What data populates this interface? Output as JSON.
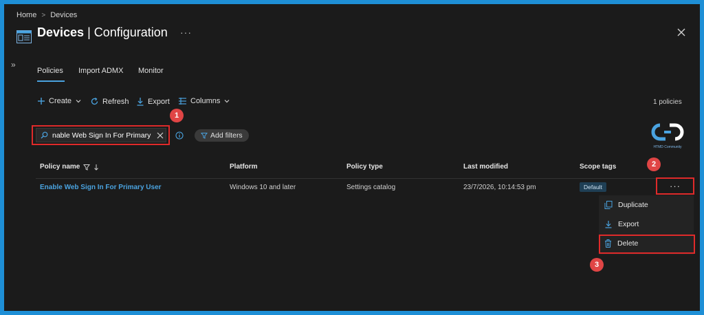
{
  "breadcrumb": {
    "home": "Home",
    "current": "Devices",
    "separator": ">"
  },
  "header": {
    "title_bold": "Devices",
    "title_rest": " | Configuration",
    "more": "···"
  },
  "tabs": [
    {
      "label": "Policies",
      "selected": true
    },
    {
      "label": "Import ADMX",
      "selected": false
    },
    {
      "label": "Monitor",
      "selected": false
    }
  ],
  "toolbar": {
    "create": "Create",
    "refresh": "Refresh",
    "export": "Export",
    "columns": "Columns",
    "count": "1 policies"
  },
  "search": {
    "value": "nable Web Sign In For Primary"
  },
  "filters": {
    "add_label": "Add filters"
  },
  "logo": {
    "text": "HTMD Community"
  },
  "table": {
    "headers": [
      "Policy name",
      "Platform",
      "Policy type",
      "Last modified",
      "Scope tags"
    ],
    "rows": [
      {
        "policy_name": "Enable Web Sign In For Primary User",
        "platform": "Windows 10 and later",
        "policy_type": "Settings catalog",
        "last_modified": "23/7/2026, 10:14:53 pm",
        "scope_tag": "Default"
      }
    ]
  },
  "row_more": "···",
  "context_menu": {
    "items": [
      {
        "label": "Duplicate",
        "icon": "duplicate-icon"
      },
      {
        "label": "Export",
        "icon": "download-icon"
      },
      {
        "label": "Delete",
        "icon": "trash-icon"
      }
    ]
  },
  "annotations": [
    "1",
    "2",
    "3"
  ],
  "colors": {
    "accent": "#4aa3e0",
    "highlight": "#e02a2a",
    "badge": "#e04545",
    "frame": "#1e8fd6"
  }
}
